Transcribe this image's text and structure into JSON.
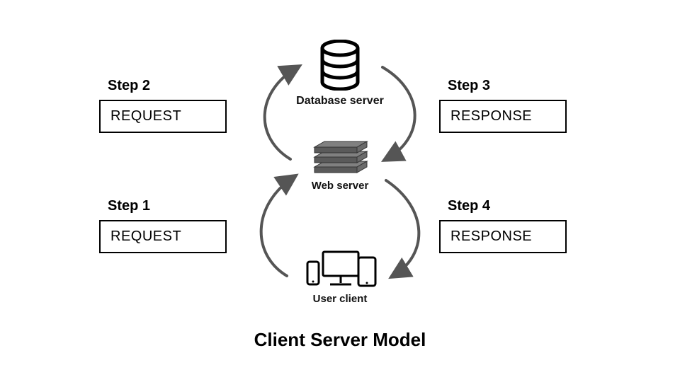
{
  "title": "Client Server Model",
  "nodes": {
    "database": {
      "label": "Database server"
    },
    "web": {
      "label": "Web server"
    },
    "user": {
      "label": "User client"
    }
  },
  "steps": {
    "s1": {
      "title": "Step 1",
      "box": "REQUEST"
    },
    "s2": {
      "title": "Step 2",
      "box": "REQUEST"
    },
    "s3": {
      "title": "Step 3",
      "box": "RESPONSE"
    },
    "s4": {
      "title": "Step 4",
      "box": "RESPONSE"
    }
  },
  "flow": {
    "description": "User client sends REQUEST (Step 1) to Web server; Web server sends REQUEST (Step 2) to Database server; Database server returns RESPONSE (Step 3) to Web server; Web server returns RESPONSE (Step 4) to User client.",
    "arrows": [
      {
        "id": "a1",
        "from": "user",
        "to": "web",
        "step": "s1"
      },
      {
        "id": "a2",
        "from": "web",
        "to": "database",
        "step": "s2"
      },
      {
        "id": "a3",
        "from": "database",
        "to": "web",
        "step": "s3"
      },
      {
        "id": "a4",
        "from": "web",
        "to": "user",
        "step": "s4"
      }
    ]
  },
  "colors": {
    "stroke": "#555555",
    "black": "#000000",
    "server_gray": "#808080",
    "server_dark": "#5a5a5a"
  }
}
